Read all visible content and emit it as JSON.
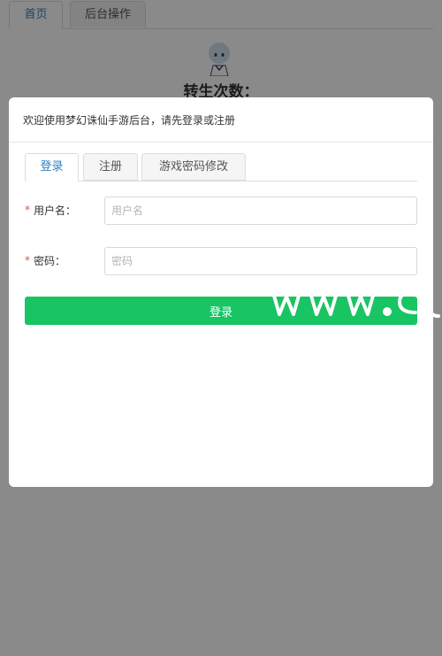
{
  "top_tabs": {
    "home": "首页",
    "backend": "后台操作"
  },
  "profile": {
    "rebirth_label": "转生次数："
  },
  "modal": {
    "title": "欢迎使用梦幻诛仙手游后台，请先登录或注册",
    "tabs": {
      "login": "登录",
      "register": "注册",
      "change_password": "游戏密码修改"
    },
    "fields": {
      "username": {
        "required_mark": "*",
        "label": "用户名：",
        "value": "",
        "placeholder": "用户名"
      },
      "password": {
        "required_mark": "*",
        "label": "密码：",
        "value": "",
        "placeholder": "密码"
      }
    },
    "submit_label": "登录"
  },
  "colors": {
    "accent": "#2b7fc2",
    "button": "#19c463",
    "required": "#d9534f",
    "overlay": "#000000"
  },
  "icons": {
    "avatar": "anime-avatar-icon",
    "watermark": "watermark-logo"
  }
}
